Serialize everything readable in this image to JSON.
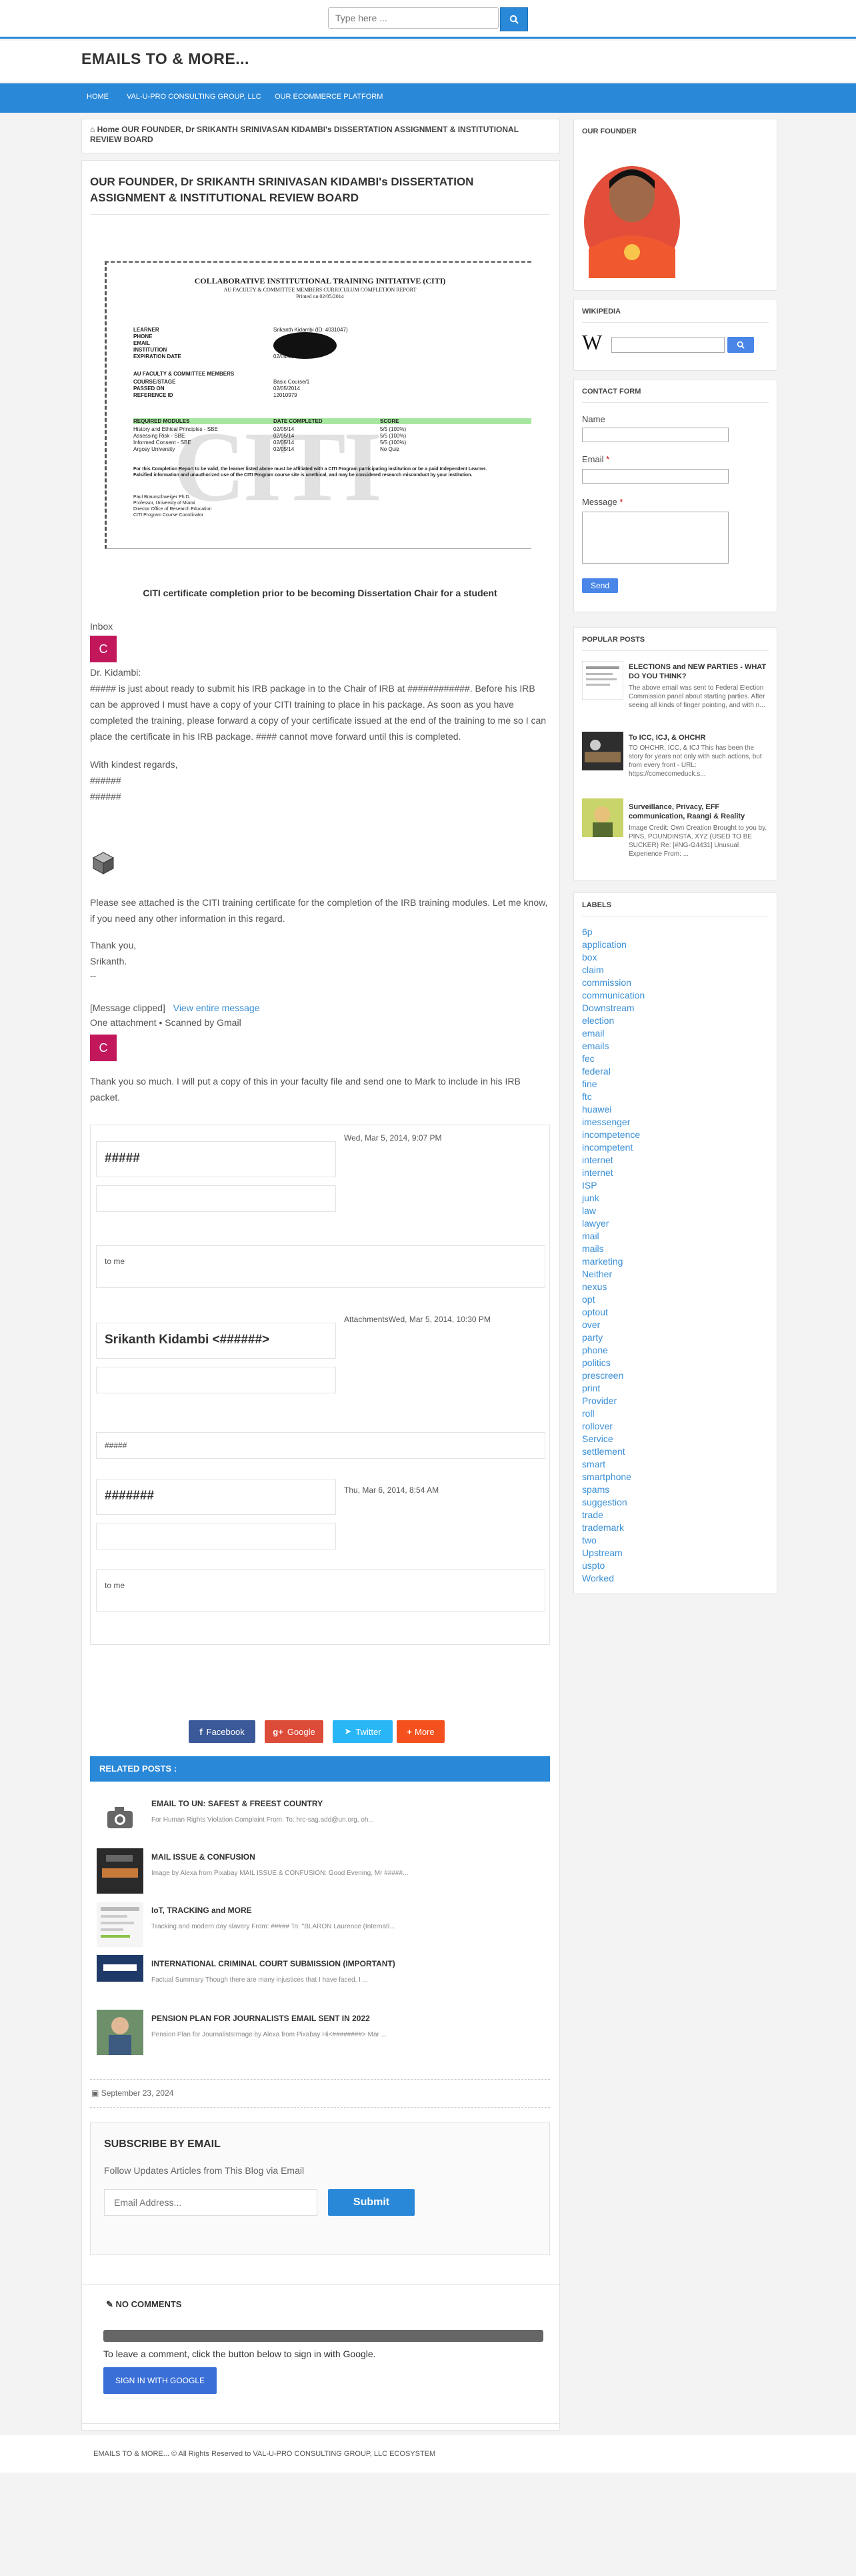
{
  "search": {
    "placeholder": "Type here ..."
  },
  "site": {
    "title": "EMAILS TO & MORE..."
  },
  "nav": [
    "HOME",
    "VAL-U-PRO CONSULTING GROUP, LLC",
    "OUR ECOMMERCE PLATFORM"
  ],
  "breadcrumb": {
    "home": "Home",
    "current": "OUR FOUNDER, Dr SRIKANTH SRINIVASAN KIDAMBI's DISSERTATION ASSIGNMENT & INSTITUTIONAL REVIEW BOARD"
  },
  "post": {
    "title": "OUR FOUNDER, Dr SRIKANTH SRINIVASAN KIDAMBI's DISSERTATION ASSIGNMENT & INSTITUTIONAL REVIEW BOARD",
    "certificate": {
      "title": "COLLABORATIVE INSTITUTIONAL TRAINING INITIATIVE (CITI)",
      "subtitle": "AU FACULTY & COMMITTEE MEMBERS CURRICULUM COMPLETION REPORT",
      "printed": "Printed on 02/05/2014",
      "learner_label": "LEARNER",
      "learner_value": "Srikanth Kidambi (ID: 4031047)",
      "phone_label": "PHONE",
      "email_label": "EMAIL",
      "institution_label": "INSTITUTION",
      "expiration_label": "EXPIRATION DATE",
      "expiration_value": "02/04/2016",
      "section": "AU FACULTY & COMMITTEE MEMBERS",
      "coursestage_label": "COURSE/STAGE",
      "coursestage_value": "Basic Course/1",
      "passed_label": "PASSED ON",
      "passed_value": "02/05/2014",
      "reference_label": "REFERENCE ID",
      "reference_value": "12010979",
      "table_headers": [
        "REQUIRED MODULES",
        "DATE COMPLETED",
        "SCORE"
      ],
      "modules": [
        [
          "History and Ethical Principles - SBE",
          "02/05/14",
          "5/5 (100%)"
        ],
        [
          "Assessing Risk - SBE",
          "02/05/14",
          "5/5 (100%)"
        ],
        [
          "Informed Consent - SBE",
          "02/05/14",
          "5/5 (100%)"
        ],
        [
          "Argosy University",
          "02/05/14",
          "No Quiz"
        ]
      ],
      "note": "For this Completion Report to be valid, the learner listed above must be affiliated with a CITI Program participating institution or be a paid Independent Learner. Falsified information and unauthorized use of the CITI Program course site is unethical, and may be considered research misconduct by your institution.",
      "signatory": [
        "Paul Braunschweiger Ph.D.",
        "Professor, University of Miami",
        "Director Office of Research Education",
        "CITI Program Course Coordinator"
      ],
      "watermark": "CITI"
    },
    "caption": "CITI certificate completion prior to be becoming Dissertation Chair for a student",
    "inbox": "Inbox",
    "avatar_letter": "C",
    "greeting": "Dr. Kidambi:",
    "paragraph1": "##### is just about ready to submit his IRB package in to the Chair of IRB at ############.  Before his IRB can be approved I must have a copy of your CITI training to place in his package.  As soon as you have completed the training, please forward a copy of your certificate issued at the end of the training to me so I can place the certificate in his IRB package.  #### cannot move forward until this is completed.",
    "regards": "With kindest regards,",
    "sig1": "######",
    "sig2": "######",
    "paragraph2": "Please see attached is the CITI training certificate for the completion of the IRB training modules. Let me know, if you need any other information in this regard.",
    "thanks": "Thank you,",
    "name": "Srikanth.",
    "dashes": "--",
    "clipped": "[Message clipped]",
    "view_entire": "View entire message",
    "attachment": "One attachment • Scanned by Gmail",
    "paragraph3": "Thank you so much.  I will put a copy of this in your faculty file and send one to Mark to include in his IRB packet.",
    "mail": [
      {
        "from": "#####",
        "date": "Wed, Mar 5, 2014, 9:07 PM",
        "to": "to me"
      },
      {
        "from": "Srikanth Kidambi <######>",
        "date": "AttachmentsWed, Mar 5, 2014, 10:30 PM",
        "to": "#####"
      },
      {
        "from": "#######",
        "date": "Thu, Mar 6, 2014, 8:54 AM",
        "to": "to me"
      }
    ],
    "share": [
      "Facebook",
      "Google",
      "Twitter",
      "More"
    ],
    "related_header": "RELATED POSTS :",
    "related": [
      {
        "title": "EMAIL TO UN: SAFEST & FREEST COUNTRY",
        "snippet": "For Human Rights Violation Complaint From: To: hrc-sag.add@un.org, oh..."
      },
      {
        "title": "MAIL ISSUE & CONFUSION",
        "snippet": "Image by Alexa from Pixabay MAIL ISSUE & CONFUSION: Good Evening, Mr #####..."
      },
      {
        "title": "IoT, TRACKING and MORE",
        "snippet": "Tracking and modern day slavery From: ##### To: \"BLARON Laurence (Internati..."
      },
      {
        "title": "INTERNATIONAL CRIMINAL COURT SUBMISSION (IMPORTANT)",
        "snippet": "Factual Summary Though there are many injustices that I have faced, I ..."
      },
      {
        "title": "PENSION PLAN FOR JOURNALISTS EMAIL SENT IN 2022",
        "snippet": "Pension Plan for JournalistsImage by Alexa from Pixabay Hi<########> Mar ..."
      }
    ],
    "date": "September 23, 2024"
  },
  "subscribe": {
    "title": "SUBSCRIBE BY EMAIL",
    "text": "Follow Updates Articles from This Blog via Email",
    "placeholder": "Email Address...",
    "button": "Submit"
  },
  "comments": {
    "title": "NO COMMENTS",
    "text": "To leave a comment, click the button below to sign in with Google.",
    "button": "SIGN IN WITH GOOGLE"
  },
  "sidebar": {
    "founder_title": "OUR FOUNDER",
    "wikipedia_title": "WIKIPEDIA",
    "contact_title": "CONTACT FORM",
    "contact_name": "Name",
    "contact_email": "Email",
    "contact_message": "Message",
    "required_mark": "*",
    "send": "Send",
    "popular_title": "POPULAR POSTS",
    "popular": [
      {
        "title": "ELECTIONS and NEW PARTIES - WHAT DO YOU THINK?",
        "snippet": "The above email was sent to Federal Election Commission panel about starting parties. After seeing all kinds of finger pointing, and with n..."
      },
      {
        "title": "To ICC, ICJ, & OHCHR",
        "snippet": "TO OHCHR, ICC, & ICJ This has been the story for years not only with such actions, but from every front  - URL: https://ccmecomeduck.s..."
      },
      {
        "title": "Surveillance, Privacy, EFF communication, Raangi & Reality",
        "snippet": "Image Credit: Own Creation Brought to you by,  PINS, POUNDINSTA, XYZ (USED TO BE SUCKER)  Re: [#NG-G4431] Unusual Experience From: ..."
      }
    ],
    "labels_title": "LABELS",
    "labels": [
      "6p",
      "application",
      "box",
      "claim",
      "commission",
      "communication",
      "Downstream",
      "election",
      "email",
      "emails",
      "fec",
      "federal",
      "fine",
      "ftc",
      "huawei",
      "imessenger",
      "incompetence",
      "incompetent",
      "internet",
      "internet",
      "ISP",
      "junk",
      "law",
      "lawyer",
      "mail",
      "mails",
      "marketing",
      "Neither",
      "nexus",
      "opt",
      "optout",
      "over",
      "party",
      "phone",
      "politics",
      "prescreen",
      "print",
      "Provider",
      "roll",
      "rollover",
      "Service",
      "settlement",
      "smart",
      "smartphone",
      "spams",
      "suggestion",
      "trade",
      "trademark",
      "two",
      "Upstream",
      "uspto",
      "Worked"
    ]
  },
  "footer": {
    "text": "EMAILS TO & MORE... © All Rights Reserved to VAL-U-PRO CONSULTING GROUP, LLC ECOSYSTEM"
  },
  "colors": {
    "accent": "#2a88d8",
    "facebook": "#3b5998",
    "google": "#dd4b39",
    "twitter": "#29b6f6",
    "more": "#f4511e",
    "avatar": "#c2185b"
  }
}
